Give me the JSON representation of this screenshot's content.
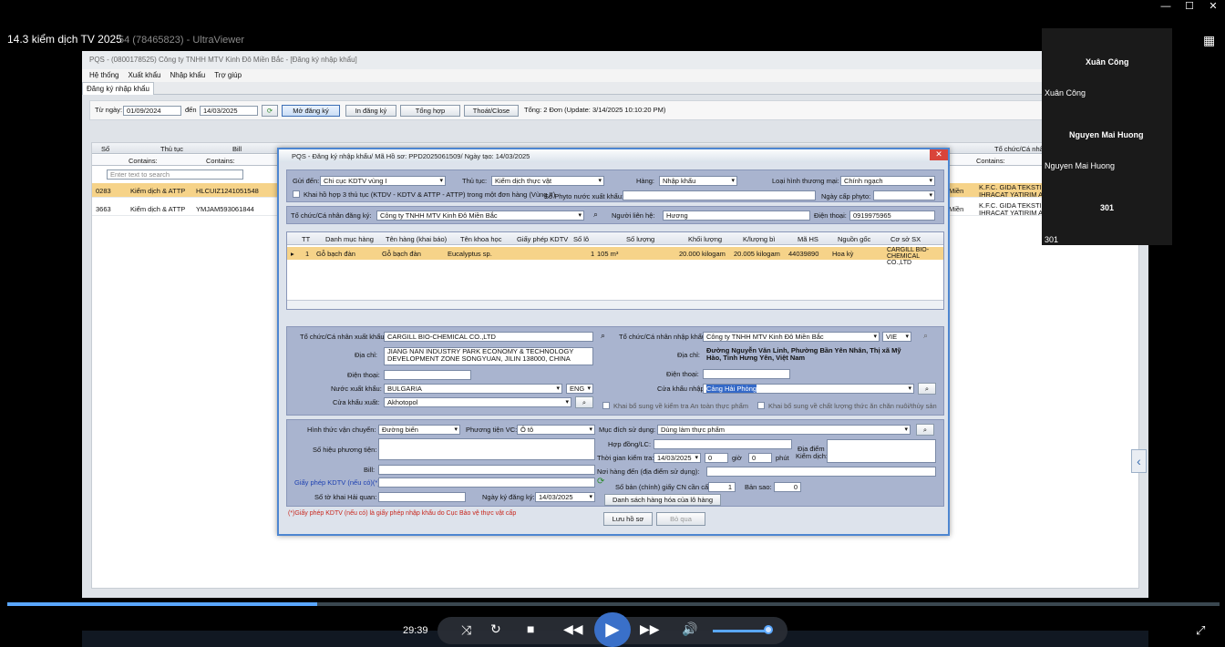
{
  "video": {
    "title": "14.3 kiểm dịch TV 2025",
    "remote_title": "54 (78465823) - UltraViewer",
    "time": "29:39"
  },
  "app": {
    "title": "PQS - (0800178525) Công ty TNHH MTV Kinh Đô Miền Bắc - [Đăng ký nhập khẩu]",
    "menu": [
      "Hệ thống",
      "Xuất khẩu",
      "Nhập khẩu",
      "Trợ giúp"
    ],
    "tab": "Đăng ký nhập khẩu",
    "filter": {
      "from_label": "Từ ngày:",
      "from": "01/09/2024",
      "to_label": "đến",
      "to": "14/03/2025",
      "btn_open": "Mở đăng ký",
      "btn_print": "In đăng ký",
      "btn_summary": "Tổng hợp",
      "btn_exit": "Thoát/Close",
      "total": "Tổng: 2 Đơn (Update: 3/14/2025 10:10:20 PM)"
    },
    "grid": {
      "headers": [
        "Số",
        "Thủ tục",
        "Bill",
        "Tổ chức/Cá nhân"
      ],
      "contains": "Contains:",
      "search_placeholder": "Enter text to search",
      "rows": [
        {
          "so": "0283",
          "thutuc": "Kiểm dịch & ATTP",
          "bill": "HLCUIZ1241051548",
          "right": "Miền",
          "org": "K.F.C. GIDA TEKSTIL SAN",
          "org2": "IHRACAT YATIRIM ANO"
        },
        {
          "so": "3663",
          "thutuc": "Kiểm dịch & ATTP",
          "bill": "YMJAM593061844",
          "right": "Miền",
          "org": "K.F.C. GIDA TEKSTIL SAN",
          "org2": "IHRACAT YATIRIM ANO"
        }
      ]
    }
  },
  "modal": {
    "title": "PQS - Đăng ký nhập khẩu/ Mã Hồ sơ: PPD2025061509/ Ngày tạo: 14/03/2025",
    "gui_den_label": "Gửi đến:",
    "gui_den": "Chi cục KDTV vùng I",
    "thu_tuc_label": "Thủ tục:",
    "thu_tuc": "Kiểm dịch thực vật",
    "hang_label": "Hàng:",
    "hang": "Nhập khẩu",
    "loai_label": "Loại hình thương mại:",
    "loai": "Chính ngạch",
    "khai_hop_label": "Khai hồ hợp 3 thủ tục (KTDV - KDTV & ATTP - ATTP) trong một đơn hàng (Vùng II)",
    "so_phyto_label": "Số Phyto nước xuất khẩu:",
    "ngay_phyto_label": "Ngày cấp phyto:",
    "to_chuc_dk_label": "Tổ chức/Cá nhân đăng ký:",
    "to_chuc_dk": "Công ty TNHH MTV Kinh Đô Miền Bắc",
    "nguoi_lh_label": "Người liên hệ:",
    "nguoi_lh": "Hương",
    "dien_thoai_label": "Điện thoại:",
    "dien_thoai": "0919975965",
    "items_headers": [
      "TT",
      "Danh mục hàng",
      "Tên hàng (khai báo)",
      "Tên khoa học",
      "Giấy phép KDTV",
      "Số lô",
      "Số lượng",
      "Khối lượng",
      "K/lượng bì",
      "Mã HS",
      "Nguồn gốc",
      "Cơ sở SX"
    ],
    "items": [
      {
        "tt": "1",
        "danh_muc": "Gỗ bạch đàn",
        "ten_hang": "Gỗ bạch đàn",
        "khoa_hoc": "Eucalyptus sp.",
        "so_lo": "1",
        "so_luong": "105 m³",
        "khoi_luong": "20.000 kilogam",
        "bi": "20.005 kilogam",
        "ma_hs": "44039890",
        "nguon_goc": "Hoa kỳ",
        "co_so": "CARGILL BIO-CHEMICAL CO.,LTD"
      }
    ],
    "xk_label": "Tổ chức/Cá nhân xuất khẩu:",
    "xk": "CARGILL BIO-CHEMICAL CO.,LTD",
    "xk_diachi_label": "Địa chỉ:",
    "xk_diachi": "JIANG NAN INDUSTRY PARK ECONOMY & TECHNOLOGY DEVELOPMENT ZONE SONGYUAN, JILIN 138000, CHINA",
    "xk_dt_label": "Điện thoại:",
    "nuoc_xk_label": "Nước xuất khẩu:",
    "nuoc_xk": "BULGARIA",
    "lang1": "ENG",
    "cua_xk_label": "Cửa khẩu xuất:",
    "cua_xk": "Akhotopol",
    "nk_label": "Tổ chức/Cá nhân nhập khẩu:",
    "nk": "Công ty TNHH MTV Kinh Đô Miền Bắc",
    "lang2": "VIE",
    "nk_diachi_label": "Địa chỉ:",
    "nk_diachi": "Đường Nguyễn Văn Linh, Phường Bần Yên Nhân, Thị xã Mỹ Hào, Tỉnh Hưng Yên, Việt Nam",
    "nk_dt_label": "Điện thoại:",
    "cua_nk_label": "Cửa khẩu nhập:",
    "cua_nk": "Cảng Hải Phòng",
    "khai_bs_attp": "Khai bổ sung về kiểm tra An toàn thực phẩm",
    "khai_bs_cl": "Khai bổ sung về chất lượng thức ăn chăn nuôi/thủy sản",
    "htvc_label": "Hình thức vận chuyển:",
    "htvc": "Đường biển",
    "ptvc_label": "Phương tiện VC:",
    "ptvc": "Ô tô",
    "mdsd_label": "Mục đích sử dụng:",
    "mdsd": "Dùng làm thực phẩm",
    "so_hieu_label": "Số hiệu phương tiện:",
    "hop_dong_label": "Hợp đồng/LC:",
    "dia_diem_label": "Địa điểm",
    "kiem_dich_label": "Kiểm dịch:",
    "tg_kiem_tra_label": "Thời gian kiểm tra:",
    "tg_kiem_tra": "14/03/2025",
    "gio": "0",
    "gio_label": "giờ",
    "phut": "0",
    "phut_label": "phút",
    "bill_label": "Bill:",
    "noi_hang_den_label": "Nơi hàng đến (địa điểm sử dụng):",
    "giay_phep_label": "Giấy phép KDTV (nếu có)(*):",
    "so_ban_label": "Số bản (chính) giấy CN cần cấp:",
    "so_ban": "1",
    "ban_sao_label": "Bản sao:",
    "ban_sao": "0",
    "so_to_khai_label": "Số tờ khai Hải quan:",
    "ngay_dk_label": "Ngày ký đăng ký:",
    "ngay_dk": "14/03/2025",
    "ds_hang": "Danh sách hàng hóa của lô hàng",
    "note": "(*)Giấy phép KDTV (nếu có) là giấy phép nhập khẩu do Cục Bảo vệ thực vật cấp",
    "btn_save": "Lưu hồ sơ",
    "btn_cancel": "Bỏ qua"
  },
  "participants": [
    {
      "name": "Xuân Công",
      "sub": "Xuân Công"
    },
    {
      "name": "Nguyen Mai Huong",
      "sub": "Nguyen Mai Huong"
    },
    {
      "name": "301",
      "sub": "301"
    }
  ]
}
